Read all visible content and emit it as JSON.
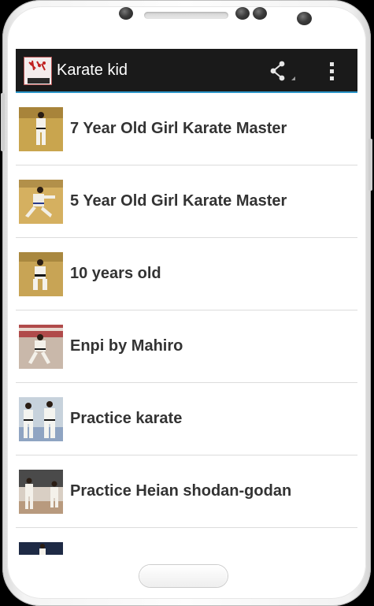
{
  "app": {
    "title": "Karate kid",
    "logo_text": "KARATE",
    "logo_subtext": "KID"
  },
  "action_bar": {
    "share_icon": "share-icon",
    "overflow_icon": "overflow-menu-icon"
  },
  "videos": [
    {
      "title": "7 Year Old Girl Karate Master"
    },
    {
      "title": "5 Year Old Girl Karate Master"
    },
    {
      "title": "10 years old"
    },
    {
      "title": "Enpi by Mahiro"
    },
    {
      "title": "Practice karate"
    },
    {
      "title": "Practice Heian shodan-godan"
    },
    {
      "title": ""
    }
  ],
  "colors": {
    "action_bar_bg": "#1a1a1a",
    "action_bar_accent": "#2d96c8",
    "row_text": "#333333",
    "divider": "#dcdcdc"
  }
}
